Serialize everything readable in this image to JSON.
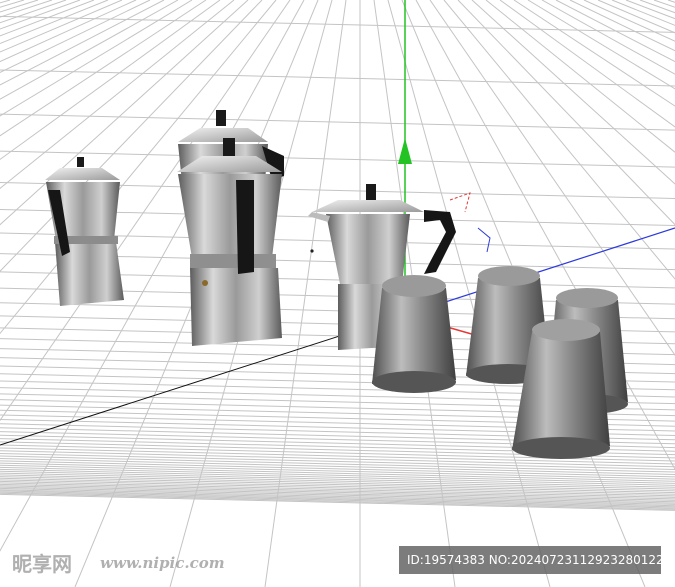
{
  "scene": {
    "description_objects": [
      "moka-pot-small",
      "moka-pot-large-back",
      "moka-pot-large-front",
      "moka-pot-medium",
      "cup-1",
      "cup-2",
      "cup-3",
      "cup-4"
    ],
    "colors": {
      "grid": "#bdbdbd",
      "x_axis": "#e53935",
      "y_axis": "#22c322",
      "z_axis": "#2d3bdc",
      "metal_light": "#d9d9d9",
      "metal_dark": "#6b6b6b",
      "handle": "#161616"
    }
  },
  "watermark": {
    "site_text": "昵享网",
    "url_text": "www.nipic.com",
    "id_text": "ID:19574383 NO:20240723112923280122"
  }
}
